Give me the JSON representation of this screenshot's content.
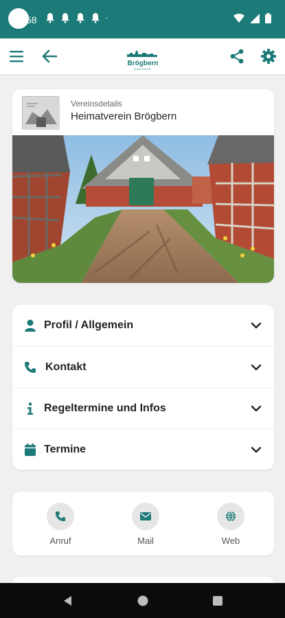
{
  "status_bar": {
    "time": "58",
    "notification_icons": [
      "bell-icon",
      "bell-icon",
      "bell-icon",
      "bell-icon"
    ],
    "system_icons": [
      "wifi-icon",
      "signal-icon",
      "battery-icon"
    ]
  },
  "app_bar": {
    "menu_icon": "menu-icon",
    "back_icon": "arrow-back-icon",
    "logo_text": "Brögbern",
    "logo_subtext": "DORFAPP",
    "share_icon": "share-icon",
    "settings_icon": "gear-icon"
  },
  "club": {
    "kicker": "Vereinsdetails",
    "name": "Heimatverein Brögbern"
  },
  "sections": [
    {
      "label": "Profil / Allgemein",
      "icon": "person-icon"
    },
    {
      "label": "Kontakt",
      "icon": "phone-icon"
    },
    {
      "label": "Regeltermine und Infos",
      "icon": "info-icon"
    },
    {
      "label": "Termine",
      "icon": "calendar-icon"
    }
  ],
  "contact_actions": [
    {
      "label": "Anruf",
      "icon": "phone-icon"
    },
    {
      "label": "Mail",
      "icon": "mail-icon"
    },
    {
      "label": "Web",
      "icon": "globe-icon"
    }
  ],
  "colors": {
    "accent": "#1c7a78",
    "background": "#f0f0f0",
    "card": "#ffffff",
    "navbar": "#0b0b0b"
  }
}
